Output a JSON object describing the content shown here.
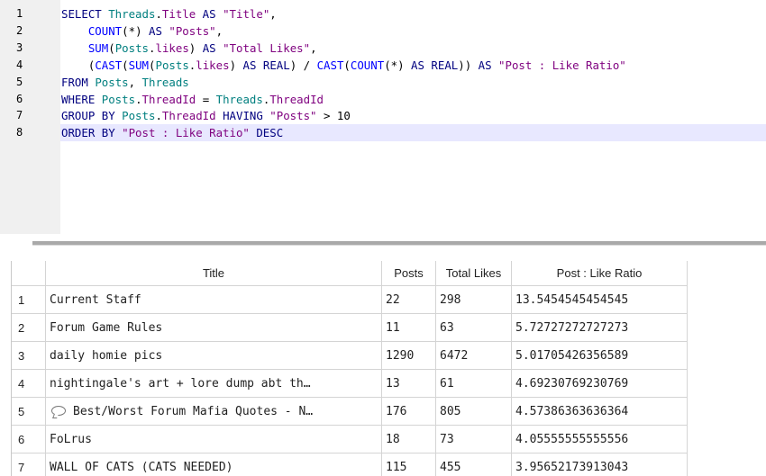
{
  "editor": {
    "line_numbers": [
      "1",
      "2",
      "3",
      "4",
      "5",
      "6",
      "7",
      "8"
    ],
    "lines": [
      [
        [
          "kw",
          "SELECT "
        ],
        [
          "id",
          "Threads"
        ],
        [
          "op",
          "."
        ],
        [
          "col",
          "Title"
        ],
        [
          "kw",
          " AS "
        ],
        [
          "str",
          "\"Title\""
        ],
        [
          "op",
          ","
        ]
      ],
      [
        [
          "op",
          "    "
        ],
        [
          "fn",
          "COUNT"
        ],
        [
          "op",
          "(*) "
        ],
        [
          "kw",
          "AS "
        ],
        [
          "str",
          "\"Posts\""
        ],
        [
          "op",
          ","
        ]
      ],
      [
        [
          "op",
          "    "
        ],
        [
          "fn",
          "SUM"
        ],
        [
          "op",
          "("
        ],
        [
          "id",
          "Posts"
        ],
        [
          "op",
          "."
        ],
        [
          "col",
          "likes"
        ],
        [
          "op",
          ") "
        ],
        [
          "kw",
          "AS "
        ],
        [
          "str",
          "\"Total Likes\""
        ],
        [
          "op",
          ","
        ]
      ],
      [
        [
          "op",
          "    ("
        ],
        [
          "fn",
          "CAST"
        ],
        [
          "op",
          "("
        ],
        [
          "fn",
          "SUM"
        ],
        [
          "op",
          "("
        ],
        [
          "id",
          "Posts"
        ],
        [
          "op",
          "."
        ],
        [
          "col",
          "likes"
        ],
        [
          "op",
          ") "
        ],
        [
          "kw",
          "AS REAL"
        ],
        [
          "op",
          ") / "
        ],
        [
          "fn",
          "CAST"
        ],
        [
          "op",
          "("
        ],
        [
          "fn",
          "COUNT"
        ],
        [
          "op",
          "(*) "
        ],
        [
          "kw",
          "AS REAL"
        ],
        [
          "op",
          ")) "
        ],
        [
          "kw",
          "AS "
        ],
        [
          "str",
          "\"Post : Like Ratio\""
        ]
      ],
      [
        [
          "kw",
          "FROM "
        ],
        [
          "id",
          "Posts"
        ],
        [
          "op",
          ", "
        ],
        [
          "id",
          "Threads"
        ]
      ],
      [
        [
          "kw",
          "WHERE "
        ],
        [
          "id",
          "Posts"
        ],
        [
          "op",
          "."
        ],
        [
          "col",
          "ThreadId"
        ],
        [
          "op",
          " = "
        ],
        [
          "id",
          "Threads"
        ],
        [
          "op",
          "."
        ],
        [
          "col",
          "ThreadId"
        ]
      ],
      [
        [
          "kw",
          "GROUP BY "
        ],
        [
          "id",
          "Posts"
        ],
        [
          "op",
          "."
        ],
        [
          "col",
          "ThreadId"
        ],
        [
          "kw",
          " HAVING "
        ],
        [
          "str",
          "\"Posts\""
        ],
        [
          "op",
          " > "
        ],
        [
          "num",
          "10"
        ]
      ],
      [
        [
          "kw",
          "ORDER BY "
        ],
        [
          "str",
          "\"Post : Like Ratio\""
        ],
        [
          "kw",
          " DESC"
        ]
      ]
    ],
    "current_line": 8
  },
  "results": {
    "columns": [
      "Title",
      "Posts",
      "Total Likes",
      "Post : Like Ratio"
    ],
    "rows": [
      {
        "num": "1",
        "title": "Current Staff",
        "icon": "",
        "posts": "22",
        "likes": "298",
        "ratio": "13.5454545454545"
      },
      {
        "num": "2",
        "title": "Forum Game Rules",
        "icon": "",
        "posts": "11",
        "likes": "63",
        "ratio": "5.72727272727273"
      },
      {
        "num": "3",
        "title": "daily homie pics",
        "icon": "",
        "posts": "1290",
        "likes": "6472",
        "ratio": "5.01705426356589"
      },
      {
        "num": "4",
        "title": "nightingale's art + lore dump abt th…",
        "icon": "",
        "posts": "13",
        "likes": "61",
        "ratio": "4.69230769230769"
      },
      {
        "num": "5",
        "title": "Best/Worst Forum Mafia Quotes - N…",
        "icon": "speech-bubble-icon",
        "posts": "176",
        "likes": "805",
        "ratio": "4.57386363636364"
      },
      {
        "num": "6",
        "title": "FoLrus",
        "icon": "",
        "posts": "18",
        "likes": "73",
        "ratio": "4.05555555555556"
      },
      {
        "num": "7",
        "title": "WALL OF CATS (CATS NEEDED)",
        "icon": "",
        "posts": "115",
        "likes": "455",
        "ratio": "3.95652173913043"
      }
    ]
  }
}
